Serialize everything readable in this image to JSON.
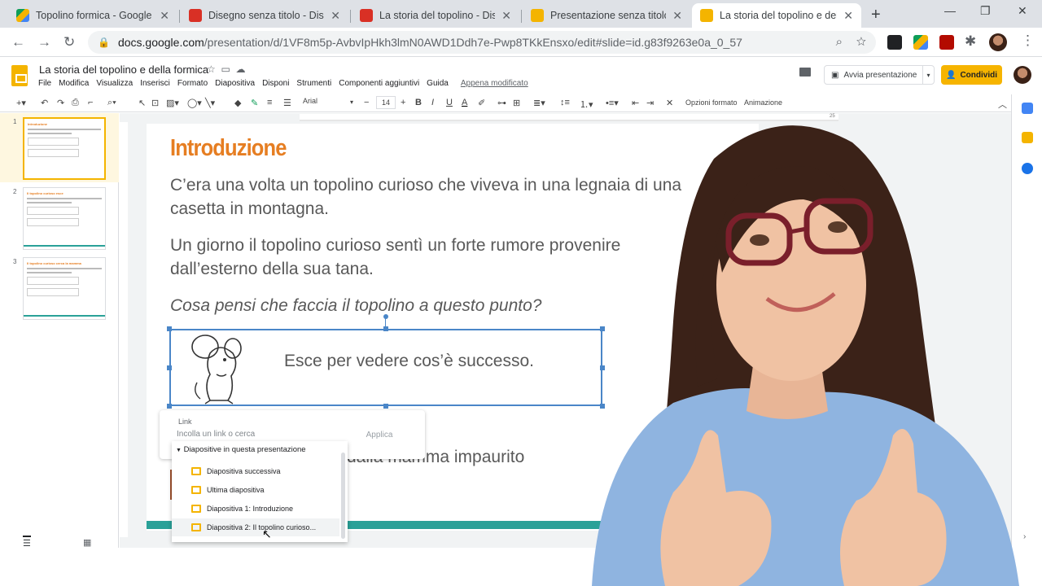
{
  "browser": {
    "tabs": [
      {
        "title": "Topolino formica - Google",
        "color": "#0f9d58",
        "icon": "drive-icon"
      },
      {
        "title": "Disegno senza titolo - Dise",
        "color": "#d93025",
        "icon": "drawings-icon"
      },
      {
        "title": "La storia del topolino - Dis",
        "color": "#d93025",
        "icon": "drawings-icon"
      },
      {
        "title": "Presentazione senza titolo",
        "color": "#f4b400",
        "icon": "slides-icon"
      },
      {
        "title": "La storia del topolino e dell",
        "color": "#f4b400",
        "icon": "slides-icon",
        "active": true
      }
    ],
    "url_host": "docs.google.com",
    "url_path": "/presentation/d/1VF8m5p-AvbvIpHkh3lmN0AWD1Ddh7e-Pwp8TKkEnsxo/edit#slide=id.g83f9263e0a_0_57"
  },
  "app": {
    "doc_title": "La storia del topolino e della formica",
    "menu": [
      "File",
      "Modifica",
      "Visualizza",
      "Inserisci",
      "Formato",
      "Diapositiva",
      "Disponi",
      "Strumenti",
      "Componenti aggiuntivi",
      "Guida"
    ],
    "last_edit": "Appena modificato",
    "present_label": "Avvia presentazione",
    "share_label": "Condividi"
  },
  "toolbar": {
    "font": "Arial",
    "font_size": "14",
    "format_options": "Opzioni formato",
    "animation": "Animazione"
  },
  "filmstrip": {
    "slides": [
      {
        "num": "1",
        "title": "Introduzione"
      },
      {
        "num": "2",
        "title": "Il topolino curioso esce"
      },
      {
        "num": "3",
        "title": "Il topolino curioso cerca la mamma"
      }
    ]
  },
  "ruler": {
    "end_label": "25"
  },
  "slide": {
    "title": "Introduzione",
    "p1": "C’era una volta un topolino curioso che viveva in una legnaia di una casetta in montagna.",
    "p2": "Un giorno il topolino curioso sentì un forte rumore provenire dall’esterno della sua tana.",
    "question": "Cosa pensi che faccia il topolino a questo punto?",
    "option1": "Esce per vedere cos’è successo.",
    "option2_tail": "dalla mamma impaurito"
  },
  "link_popup": {
    "label": "Link",
    "placeholder": "Incolla un link o cerca",
    "apply": "Applica",
    "section": "Diapositive in questa presentazione",
    "items": [
      "Diapositiva successiva",
      "Ultima diapositiva",
      "Diapositiva 1: Introduzione",
      "Diapositiva 2: Il topolino curioso..."
    ]
  },
  "colors": {
    "accent_orange": "#e67e22",
    "teal_bar": "#2aa198",
    "selection_blue": "#4a86c8",
    "share_yellow": "#f6b400"
  }
}
